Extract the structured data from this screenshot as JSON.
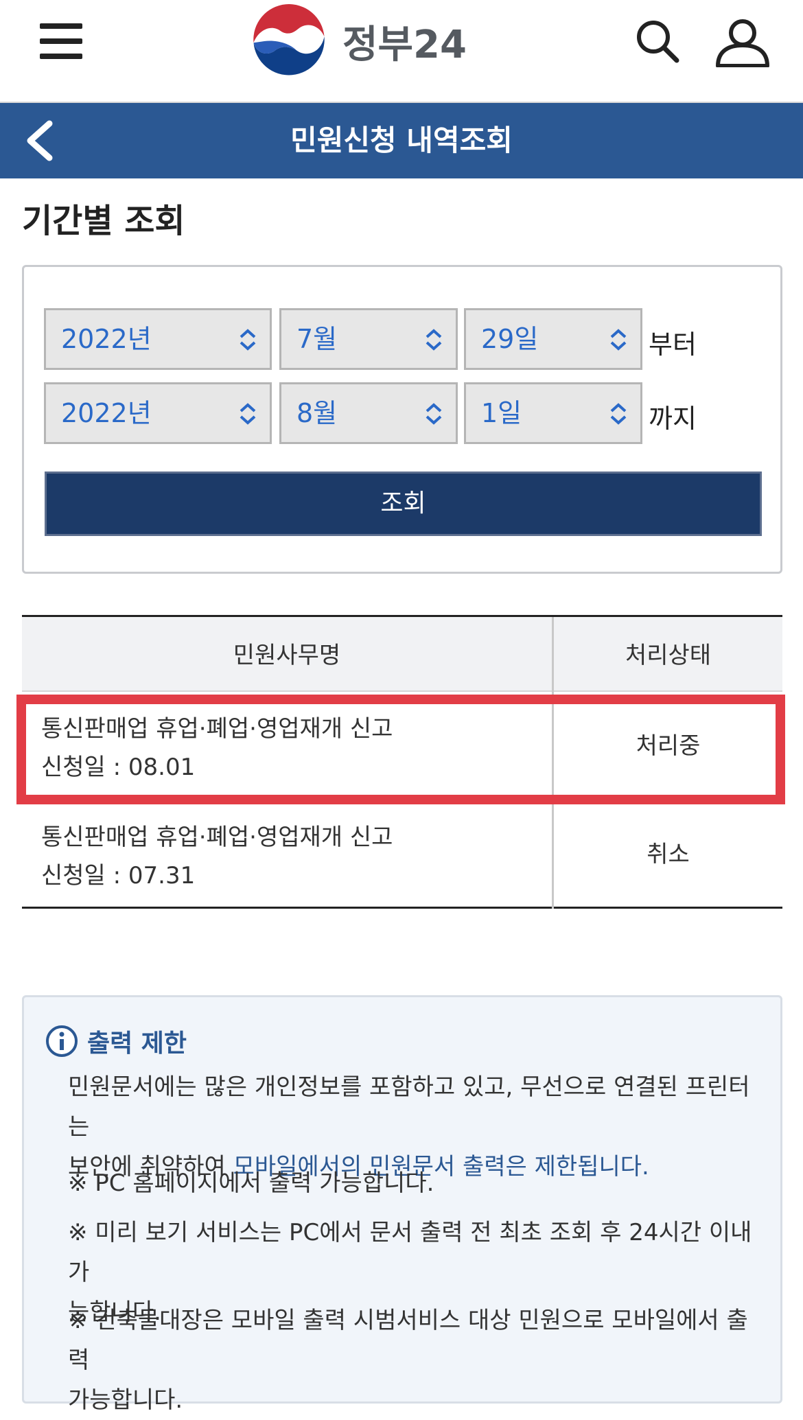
{
  "header": {
    "logo_text": "정부24",
    "page_title": "민원신청 내역조회"
  },
  "search": {
    "section_title": "기간별 조회",
    "from": {
      "year": "2022년",
      "month": "7월",
      "day": "29일",
      "suffix": "부터"
    },
    "to": {
      "year": "2022년",
      "month": "8월",
      "day": "1일",
      "suffix": "까지"
    },
    "button_label": "조회"
  },
  "table": {
    "headers": [
      "민원사무명",
      "처리상태"
    ],
    "rows": [
      {
        "name": "통신판매업 휴업·폐업·영업재개 신고",
        "date": "신청일 : 08.01",
        "status": "처리중",
        "highlighted": true
      },
      {
        "name": "통신판매업 휴업·폐업·영업재개 신고",
        "date": "신청일 : 07.31",
        "status": "취소",
        "highlighted": false
      }
    ]
  },
  "notice": {
    "title": "출력 제한",
    "body_line1": "민원문서에는 많은 개인정보를 포함하고 있고, 무선으로 연결된 프린터는",
    "body_line2_prefix": "보안에 취약하여 ",
    "body_line2_highlight": "모바일에서의 민원문서 출력은 제한됩니다.",
    "note1": "※ PC 홈페이지에서 출력 가능합니다.",
    "note2_line1": "※ 미리 보기 서비스는 PC에서 문서 출력 전 최초 조회 후 24시간 이내 가",
    "note2_line2": "능합니다.",
    "note3_line1": "※ 건축물대장은 모바일 출력 시범서비스 대상 민원으로 모바일에서 출력",
    "note3_line2": "가능합니다."
  },
  "colors": {
    "title_bar": "#2b5893",
    "button": "#1c3a68",
    "select_text": "#2a69c8",
    "highlight_box": "#e23d46"
  },
  "icons": [
    "menu-icon",
    "gov-logo",
    "search-icon",
    "user-icon",
    "back-arrow-icon",
    "updown-arrow-icon",
    "info-icon"
  ]
}
